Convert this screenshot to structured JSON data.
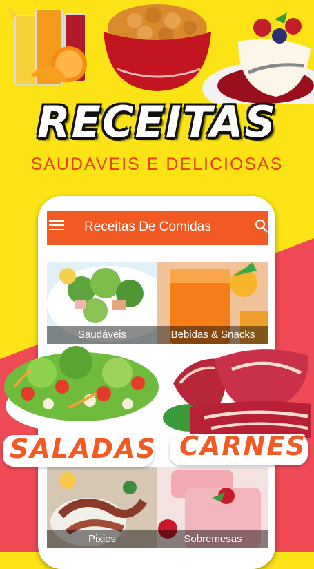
{
  "hero": {
    "title": "RECEITAS",
    "subtitle": "SAUDAVEIS E DELICIOSAS"
  },
  "app": {
    "title": "Receitas De Comidas",
    "menu_icon": "hamburger-menu-icon",
    "search_icon": "search-icon",
    "accent": "#f15a22"
  },
  "categories": [
    {
      "label": "Saudáveis"
    },
    {
      "label": "Bebidas & Snacks"
    },
    {
      "label": "Pixies"
    },
    {
      "label": "Sobremesas"
    }
  ],
  "banners": {
    "left": "SALADAS",
    "right": "CARNES"
  },
  "colors": {
    "yellow": "#fbe316",
    "red": "#ef4a55",
    "orange": "#f15a22"
  }
}
